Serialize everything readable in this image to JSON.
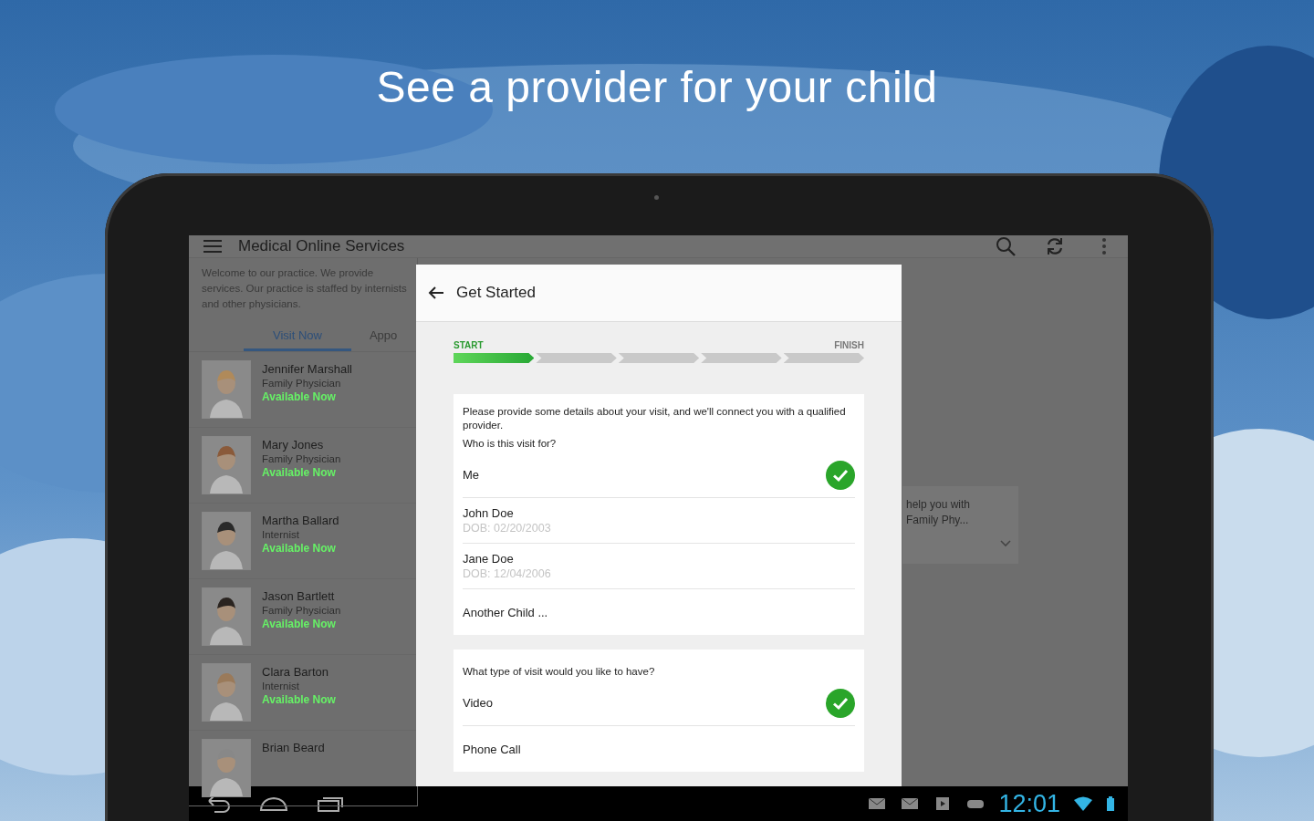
{
  "headline": "See a provider for your child",
  "app": {
    "title": "Medical Online Services",
    "welcome": "Welcome to our practice. We provide services. Our practice is staffed by internists and other physicians.",
    "tabs": [
      {
        "label": "Visit Now",
        "selected": true
      },
      {
        "label": "Appo",
        "selected": false
      }
    ],
    "providers": [
      {
        "name": "Jennifer Marshall",
        "specialty": "Family Physician",
        "status": "Available Now"
      },
      {
        "name": "Mary Jones",
        "specialty": "Family Physician",
        "status": "Available Now"
      },
      {
        "name": "Martha Ballard",
        "specialty": "Internist",
        "status": "Available Now"
      },
      {
        "name": "Jason Bartlett",
        "specialty": "Family Physician",
        "status": "Available Now"
      },
      {
        "name": "Clara Barton",
        "specialty": "Internist",
        "status": "Available Now"
      },
      {
        "name": "Brian Beard"
      }
    ],
    "side_card": {
      "lines": [
        "help you with",
        "Family Phy..."
      ]
    }
  },
  "dialog": {
    "title": "Get Started",
    "progress": {
      "start": "START",
      "finish": "FINISH",
      "steps": [
        {
          "done": true
        },
        {
          "done": false
        },
        {
          "done": false
        },
        {
          "done": false
        },
        {
          "done": false
        }
      ]
    },
    "sections": [
      {
        "intro": "Please provide some details about your visit, and we'll connect you with a qualified provider.",
        "question": "Who is this visit for?",
        "options": [
          {
            "label": "Me",
            "selected": true
          },
          {
            "label": "John Doe",
            "detail": "DOB: 02/20/2003",
            "selected": false
          },
          {
            "label": "Jane Doe",
            "detail": "DOB: 12/04/2006",
            "selected": false
          },
          {
            "label": "Another Child ...",
            "selected": false
          }
        ]
      },
      {
        "question": "What type of visit would you like to have?",
        "options": [
          {
            "label": "Video",
            "selected": true
          },
          {
            "label": "Phone Call",
            "selected": false
          }
        ]
      }
    ]
  },
  "status_bar": {
    "time": "12:01"
  }
}
